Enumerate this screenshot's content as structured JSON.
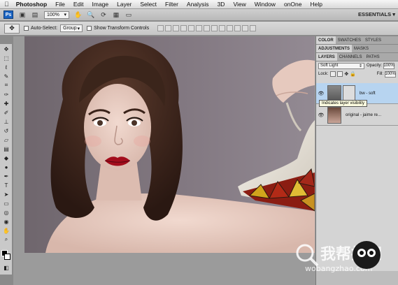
{
  "menubar": {
    "app": "Photoshop",
    "items": [
      "File",
      "Edit",
      "Image",
      "Layer",
      "Select",
      "Filter",
      "Analysis",
      "3D",
      "View",
      "Window",
      "onOne",
      "Help"
    ]
  },
  "appbar": {
    "zoom": "100%",
    "workspace": "ESSENTIALS ▾"
  },
  "options": {
    "auto_select_label": "Auto-Select:",
    "auto_select_value": "Group",
    "transform_label": "Show Transform Controls"
  },
  "panels": {
    "top_tabs": [
      "COLOR",
      "SWATCHES",
      "STYLES"
    ],
    "mid_tabs": [
      "ADJUSTMENTS",
      "MASKS"
    ],
    "layer_tabs": [
      "LAYERS",
      "CHANNELS",
      "PATHS"
    ],
    "blend_mode": "Soft Light",
    "opacity_label": "Opacity:",
    "opacity_value": "100%",
    "lock_label": "Lock:",
    "fill_label": "Fill:",
    "fill_value": "100%",
    "layers": [
      {
        "name": "bw - soft"
      },
      {
        "name": "original - jaime re..."
      }
    ],
    "tooltip": "Indicates layer visibility"
  },
  "watermark": {
    "cn": "我帮找网",
    "en": "wobangzhao.com"
  },
  "colors": {
    "accent": "#1a63c2",
    "selection": "#b7d4f0"
  }
}
